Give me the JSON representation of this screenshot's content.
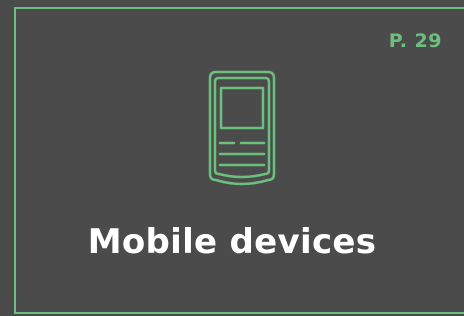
{
  "page": {
    "page_number": "P. 29",
    "title": "Mobile devices",
    "accent_color": "#6cc07e",
    "background_color": "#4b4b4b",
    "icon": "mobile-device-icon"
  }
}
